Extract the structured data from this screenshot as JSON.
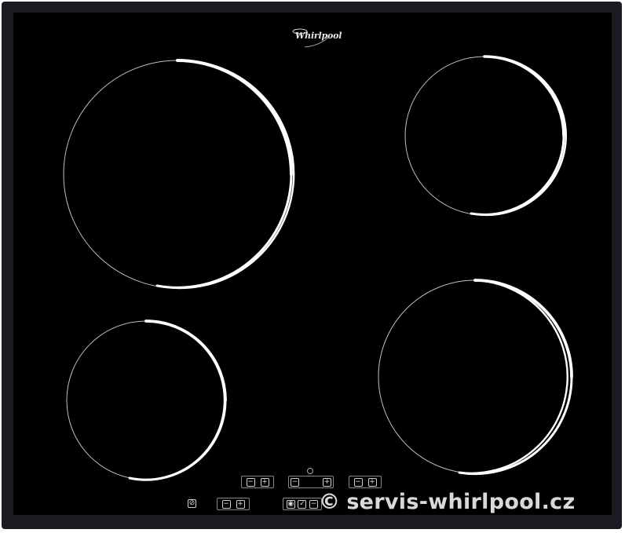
{
  "brand": {
    "name": "Whirlpool"
  },
  "controls": {
    "minus": "−",
    "plus": "+",
    "lock": "⊘",
    "check": "✓",
    "power": "◉"
  },
  "watermark": {
    "copyright": "©",
    "text": "servis-whirlpool.cz"
  },
  "colors": {
    "glass": "#000000",
    "frame": "#1b1b22",
    "ring": "#ffffff"
  }
}
